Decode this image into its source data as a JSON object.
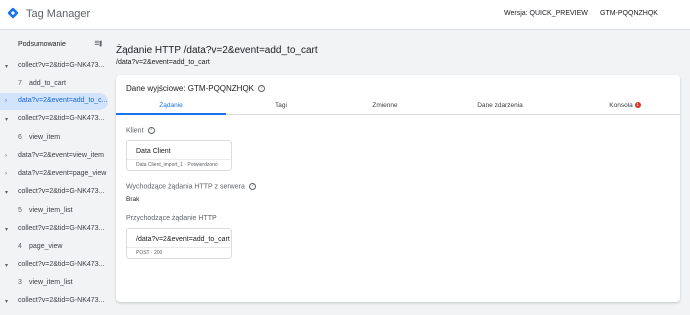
{
  "app": {
    "title": "Tag Manager",
    "logo_icon": "gtm-diamond-icon",
    "logo_color": "#1a73e8"
  },
  "header": {
    "version": "Wersja: QUICK_PREVIEW",
    "container_id": "GTM-PQQNZHQK"
  },
  "sidebar": {
    "heading": "Podsumowanie",
    "trash_icon": "delete-sweep-icon",
    "items": [
      {
        "label": "collect?v=2&tid=G-NK473...",
        "type": "group"
      },
      {
        "num": "7",
        "label": "add_to_cart",
        "type": "sub"
      },
      {
        "label": "data?v=2&event=add_to_c...",
        "type": "group",
        "active": true
      },
      {
        "label": "collect?v=2&tid=G-NK473...",
        "type": "group"
      },
      {
        "num": "6",
        "label": "view_item",
        "type": "sub"
      },
      {
        "label": "data?v=2&event=view_item",
        "type": "group"
      },
      {
        "label": "data?v=2&event=page_view",
        "type": "group"
      },
      {
        "label": "collect?v=2&tid=G-NK473...",
        "type": "group"
      },
      {
        "num": "5",
        "label": "view_item_list",
        "type": "sub"
      },
      {
        "label": "collect?v=2&tid=G-NK473...",
        "type": "group"
      },
      {
        "num": "4",
        "label": "page_view",
        "type": "sub"
      },
      {
        "label": "collect?v=2&tid=G-NK473...",
        "type": "group"
      },
      {
        "num": "3",
        "label": "view_item_list",
        "type": "sub"
      },
      {
        "label": "collect?v=2&tid=G-NK473...",
        "type": "group"
      }
    ]
  },
  "main": {
    "title": "Żądanie HTTP /data?v=2&event=add_to_cart",
    "subtitle": "/data?v=2&event=add_to_cart",
    "card": {
      "heading": "Dane wyjściowe: GTM-PQQNZHQK",
      "tabs": [
        {
          "label": "Żądanie",
          "active": true
        },
        {
          "label": "Tagi"
        },
        {
          "label": "Zmienne"
        },
        {
          "label": "Dane zdarzenia"
        },
        {
          "label": "Konsola",
          "badge": "1"
        }
      ],
      "client_label": "Klient",
      "client_box": {
        "title": "Data Client",
        "sub": "Data Client_import_1 · Potwierdzono"
      },
      "outgoing_label": "Wychodzące żądania HTTP z serwera",
      "outgoing_value": "Brak",
      "incoming_label": "Przychodzące żądanie HTTP",
      "incoming_box": {
        "title": "/data?v=2&event=add_to_cart",
        "sub": "POST · 200"
      }
    }
  },
  "colors": {
    "accent": "#1a73e8",
    "active_bg": "#d2e3fc",
    "badge": "#d93025"
  }
}
